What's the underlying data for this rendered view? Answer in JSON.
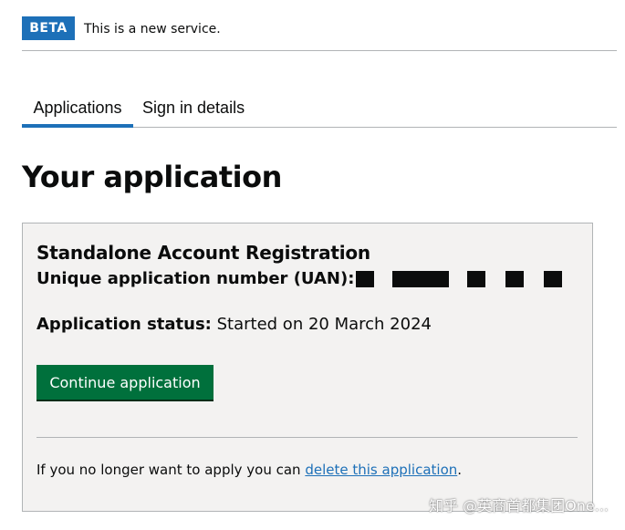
{
  "phase_banner": {
    "tag": "BETA",
    "text": "This is a new service."
  },
  "tabs": [
    {
      "label": "Applications",
      "active": true
    },
    {
      "label": "Sign in details",
      "active": false
    }
  ],
  "page_title": "Your application",
  "application": {
    "title": "Standalone Account Registration",
    "uan_label": "Unique application number (UAN):",
    "status_label": "Application status:",
    "status_value": "Started on 20 March 2024",
    "continue_label": "Continue application",
    "delete_prefix": "If you no longer want to apply you can",
    "delete_link": "delete this application",
    "delete_suffix": "."
  },
  "watermark": "知乎 @英商首都集团One...",
  "colors": {
    "beta_blue": "#1d70b8",
    "button_green": "#00703c",
    "card_background": "#f3f2f1",
    "link_blue": "#1d70b8"
  }
}
